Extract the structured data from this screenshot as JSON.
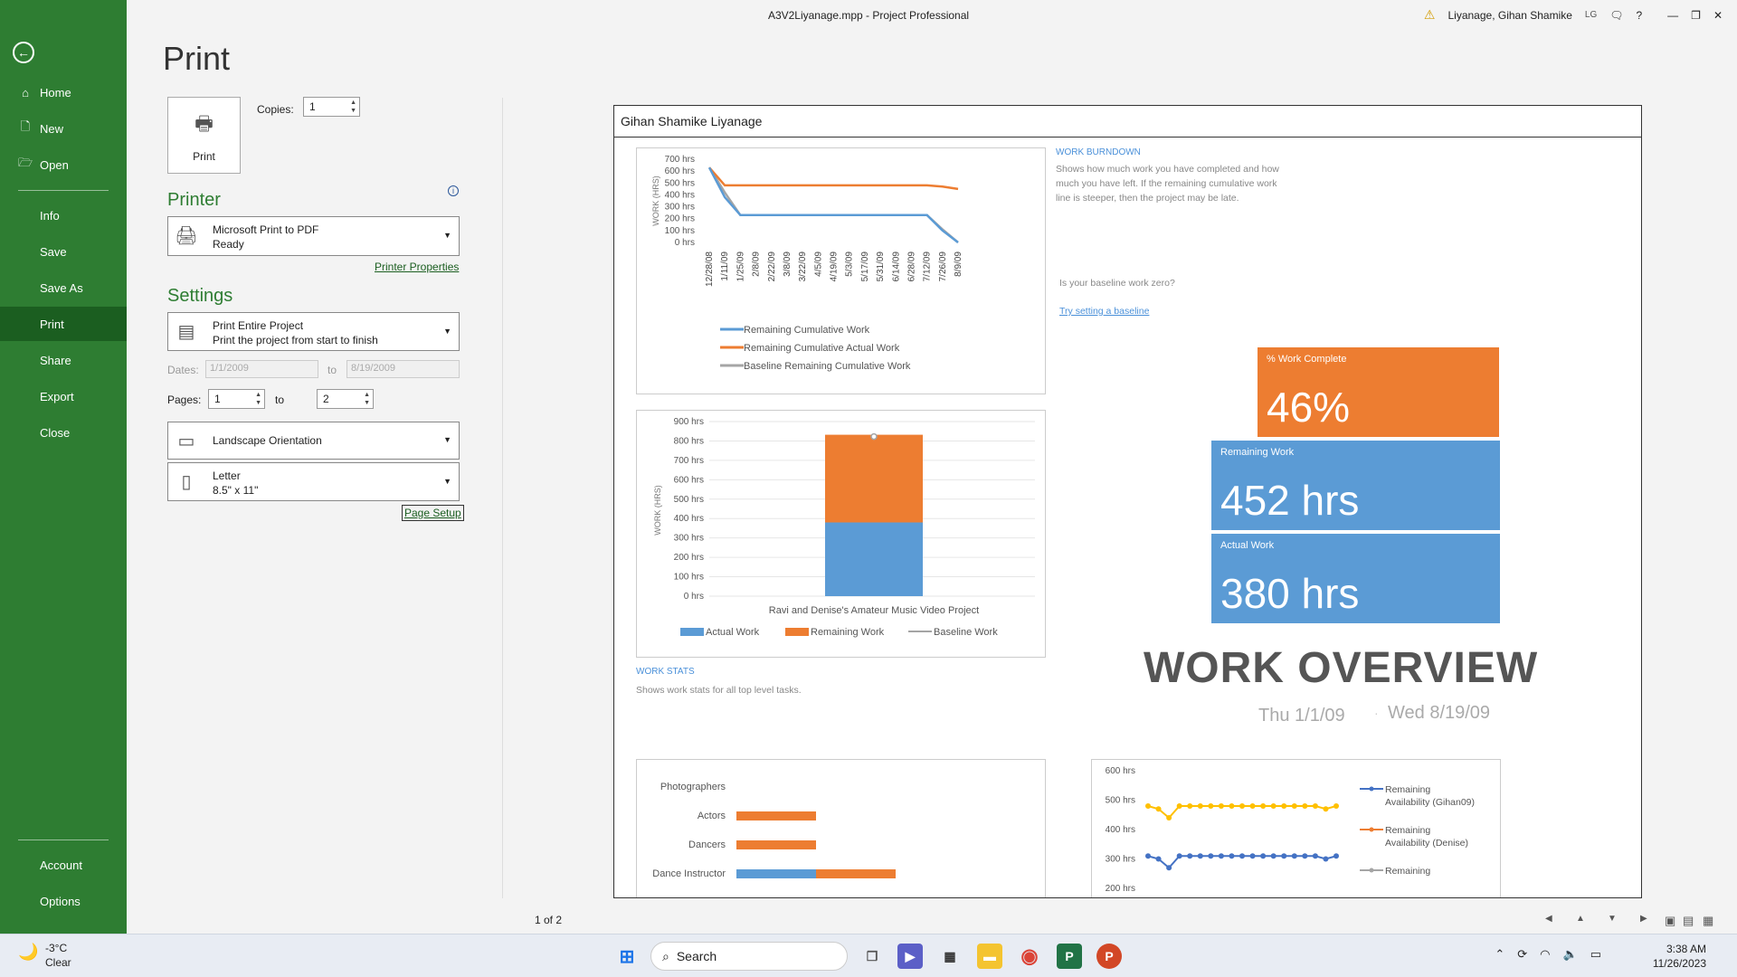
{
  "window": {
    "title": "A3V2Liyanage.mpp  -  Project Professional",
    "user": "Liyanage, Gihan Shamike",
    "user_initials": "LG"
  },
  "sidebar": {
    "back": "←",
    "items": [
      {
        "label": "Home",
        "icon": "⌂"
      },
      {
        "label": "New",
        "icon": "🗋"
      },
      {
        "label": "Open",
        "icon": "🗁"
      },
      {
        "label": "Info"
      },
      {
        "label": "Save"
      },
      {
        "label": "Save As"
      },
      {
        "label": "Print"
      },
      {
        "label": "Share"
      },
      {
        "label": "Export"
      },
      {
        "label": "Close"
      }
    ],
    "bottom": [
      {
        "label": "Account"
      },
      {
        "label": "Options"
      }
    ]
  },
  "print": {
    "title": "Print",
    "button": "Print",
    "copies_label": "Copies:",
    "copies": "1",
    "printer_header": "Printer",
    "printer_name": "Microsoft Print to PDF",
    "printer_status": "Ready",
    "printer_properties": "Printer Properties",
    "settings_header": "Settings",
    "scope_title": "Print Entire Project",
    "scope_desc": "Print the project from start to finish",
    "dates_label": "Dates:",
    "date_from": "1/1/2009",
    "to_label": "to",
    "date_to": "8/19/2009",
    "pages_label": "Pages:",
    "page_from": "1",
    "page_to": "2",
    "orientation": "Landscape Orientation",
    "paper": "Letter",
    "paper_size": "8.5\" x 11\"",
    "page_setup": "Page Setup",
    "pager": "1 of 2"
  },
  "preview": {
    "header": "Gihan Shamike Liyanage",
    "burndown_title": "WORK BURNDOWN",
    "burndown_desc": "Shows how much work you have completed and how much you have left. If the remaining cumulative work line is steeper, then the project may be late.",
    "baseline_q": "Is your baseline work zero?",
    "baseline_link": "Try setting a baseline",
    "stats_title": "WORK STATS",
    "stats_desc": "Shows work stats for all top level tasks.",
    "tiles": [
      {
        "label": "% Work Complete",
        "value": "46%",
        "color": "#ed7d31"
      },
      {
        "label": "Remaining Work",
        "value": "452 hrs",
        "color": "#5b9bd5"
      },
      {
        "label": "Actual Work",
        "value": "380 hrs",
        "color": "#5b9bd5"
      }
    ],
    "overview_title": "WORK OVERVIEW",
    "start_date": "Thu 1/1/09",
    "end_date": "Wed 8/19/09",
    "work_fraction": 0.46
  },
  "chart_data": [
    {
      "type": "line",
      "ylabel": "WORK (HRS)",
      "y_ticks": [
        "700 hrs",
        "600 hrs",
        "500 hrs",
        "400 hrs",
        "300 hrs",
        "200 hrs",
        "100 hrs",
        "0 hrs"
      ],
      "x": [
        "12/28/08",
        "1/11/09",
        "1/25/09",
        "2/8/09",
        "2/22/09",
        "3/8/09",
        "3/22/09",
        "4/5/09",
        "4/19/09",
        "5/3/09",
        "5/17/09",
        "5/31/09",
        "6/14/09",
        "6/28/09",
        "7/12/09",
        "7/26/09",
        "8/9/09"
      ],
      "ylim": [
        0,
        700
      ],
      "series": [
        {
          "name": "Remaining Cumulative Work",
          "color": "#5b9bd5",
          "values": [
            630,
            380,
            230,
            230,
            230,
            230,
            230,
            230,
            230,
            230,
            230,
            230,
            230,
            230,
            230,
            100,
            0
          ]
        },
        {
          "name": "Remaining Cumulative Actual Work",
          "color": "#ed7d31",
          "values": [
            630,
            480,
            480,
            480,
            480,
            480,
            480,
            480,
            480,
            480,
            480,
            480,
            480,
            480,
            480,
            470,
            450
          ]
        },
        {
          "name": "Baseline Remaining Cumulative Work",
          "color": "#a5a5a5",
          "values": [
            630,
            420,
            230,
            230,
            230,
            230,
            230,
            230,
            230,
            230,
            230,
            230,
            230,
            230,
            230,
            110,
            0
          ]
        }
      ]
    },
    {
      "type": "bar",
      "ylabel": "WORK (HRS)",
      "y_ticks": [
        "900 hrs",
        "800 hrs",
        "700 hrs",
        "600 hrs",
        "500 hrs",
        "400 hrs",
        "300 hrs",
        "200 hrs",
        "100 hrs",
        "0 hrs"
      ],
      "ylim": [
        0,
        900
      ],
      "categories": [
        "Ravi and Denise's Amateur Music Video Project"
      ],
      "series": [
        {
          "name": "Actual Work",
          "color": "#5b9bd5",
          "values": [
            380
          ]
        },
        {
          "name": "Remaining Work",
          "color": "#ed7d31",
          "values": [
            452
          ]
        },
        {
          "name": "Baseline Work",
          "color": "#a5a5a5",
          "values": [
            0
          ]
        }
      ]
    },
    {
      "type": "bar",
      "orientation": "horizontal",
      "categories": [
        "Photographers",
        "Actors",
        "Dancers",
        "Dance Instructor"
      ],
      "series": [
        {
          "name": "Actual Work",
          "color": "#5b9bd5",
          "values": [
            0,
            0,
            0,
            40
          ]
        },
        {
          "name": "Remaining Work",
          "color": "#ed7d31",
          "values": [
            0,
            40,
            40,
            40
          ]
        }
      ]
    },
    {
      "type": "line",
      "y_ticks": [
        "600 hrs",
        "500 hrs",
        "400 hrs",
        "300 hrs",
        "200 hrs"
      ],
      "ylim": [
        200,
        600
      ],
      "series": [
        {
          "name": "Remaining Availability (Gihan09)",
          "color": "#ffc000",
          "values": [
            480,
            470,
            440,
            480,
            480,
            480,
            480,
            480,
            480,
            480,
            480,
            480,
            480,
            480,
            480,
            480,
            480,
            470,
            480
          ]
        },
        {
          "name": "Remaining Availability (Denise)",
          "color": "#4472c4",
          "values": [
            310,
            300,
            270,
            310,
            310,
            310,
            310,
            310,
            310,
            310,
            310,
            310,
            310,
            310,
            310,
            310,
            310,
            300,
            310
          ]
        },
        {
          "name": "Remaining",
          "color": "#a5a5a5",
          "values": []
        }
      ]
    }
  ],
  "legend_labels": {
    "burndown": [
      "Remaining Cumulative Work",
      "Remaining Cumulative Actual Work",
      "Baseline Remaining Cumulative Work"
    ],
    "stats": [
      "Actual Work",
      "Remaining Work",
      "Baseline Work"
    ],
    "avail": [
      "Remaining Availability (Gihan09)",
      "Remaining Availability (Denise)",
      "Remaining"
    ],
    "avail_lines": [
      [
        "Remaining",
        "Availability (Gihan09)"
      ],
      [
        "Remaining",
        "Availability (Denise)"
      ],
      [
        "Remaining"
      ]
    ]
  },
  "taskbar": {
    "weather_temp": "-3°C",
    "weather_desc": "Clear",
    "search": "Search",
    "time": "3:38 AM",
    "date": "11/26/2023"
  }
}
